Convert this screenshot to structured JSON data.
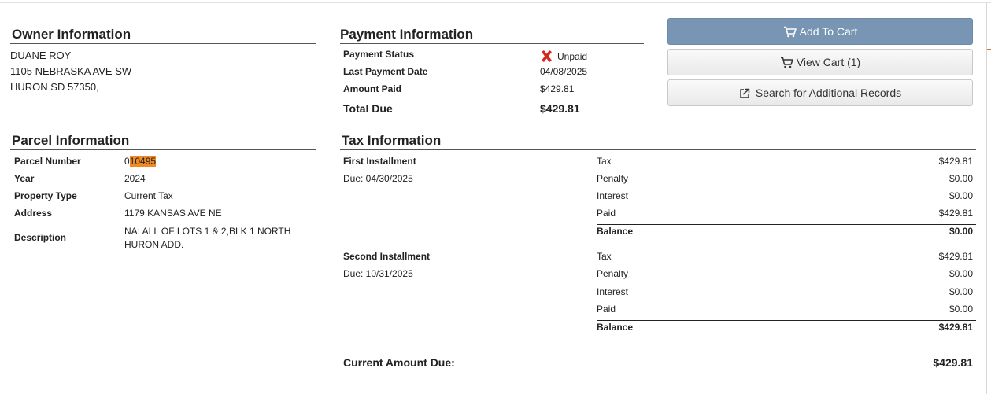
{
  "owner": {
    "title": "Owner Information",
    "name": "DUANE ROY",
    "address_line1": "1105 NEBRASKA AVE SW",
    "address_line2": "HURON SD 57350,"
  },
  "payment": {
    "title": "Payment Information",
    "status_label": "Payment Status",
    "status_value": "Unpaid",
    "status_icon": "x-mark-icon",
    "last_payment_label": "Last Payment Date",
    "last_payment_value": "04/08/2025",
    "amount_paid_label": "Amount Paid",
    "amount_paid_value": "$429.81",
    "total_due_label": "Total Due",
    "total_due_value": "$429.81"
  },
  "actions": {
    "add_to_cart": "Add To Cart",
    "view_cart": "View Cart (1)",
    "search_additional": "Search for Additional Records"
  },
  "parcel": {
    "title": "Parcel Information",
    "parcel_number_label": "Parcel Number",
    "parcel_number_prefix": "0",
    "parcel_number_highlight": "10495",
    "year_label": "Year",
    "year_value": "2024",
    "property_type_label": "Property Type",
    "property_type_value": "Current Tax",
    "address_label": "Address",
    "address_value": "1179 KANSAS AVE NE",
    "description_label": "Description",
    "description_value": "NA: ALL OF LOTS 1 & 2,BLK 1 NORTH HURON ADD."
  },
  "tax": {
    "title": "Tax Information",
    "installments": [
      {
        "name": "First Installment",
        "due": "Due: 04/30/2025",
        "rows": [
          {
            "label": "Tax",
            "value": "$429.81"
          },
          {
            "label": "Penalty",
            "value": "$0.00"
          },
          {
            "label": "Interest",
            "value": "$0.00"
          },
          {
            "label": "Paid",
            "value": "$429.81"
          }
        ],
        "balance_label": "Balance",
        "balance_value": "$0.00"
      },
      {
        "name": "Second Installment",
        "due": "Due: 10/31/2025",
        "rows": [
          {
            "label": "Tax",
            "value": "$429.81"
          },
          {
            "label": "Penalty",
            "value": "$0.00"
          },
          {
            "label": "Interest",
            "value": "$0.00"
          },
          {
            "label": "Paid",
            "value": "$0.00"
          }
        ],
        "balance_label": "Balance",
        "balance_value": "$429.81"
      }
    ],
    "current_due_label": "Current Amount Due:",
    "current_due_value": "$429.81"
  },
  "colors": {
    "primary_button": "#7895b3",
    "highlight": "#f08a24",
    "unpaid_icon": "#d9261c"
  }
}
